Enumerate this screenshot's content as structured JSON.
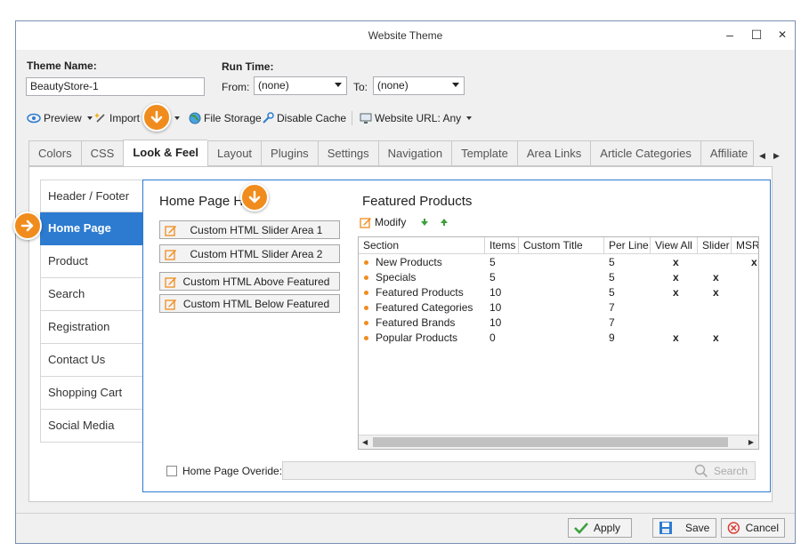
{
  "window": {
    "title": "Website Theme",
    "controls": {
      "minimize": "–",
      "maximize": "☐",
      "close": "✕"
    }
  },
  "header": {
    "theme_name_label": "Theme Name:",
    "theme_name_value": "BeautyStore-1",
    "run_time_label": "Run Time:",
    "from_label": "From:",
    "from_value": "(none)",
    "to_label": "To:",
    "to_value": "(none)"
  },
  "toolbar": {
    "preview": "Preview",
    "import": "Import",
    "file_storage": "File Storage",
    "disable_cache": "Disable Cache",
    "website_url": "Website URL: Any"
  },
  "tabs": [
    {
      "label": "Colors"
    },
    {
      "label": "CSS"
    },
    {
      "label": "Look & Feel"
    },
    {
      "label": "Layout"
    },
    {
      "label": "Plugins"
    },
    {
      "label": "Settings"
    },
    {
      "label": "Navigation"
    },
    {
      "label": "Template"
    },
    {
      "label": "Area Links"
    },
    {
      "label": "Article Categories"
    },
    {
      "label": "Affiliate"
    }
  ],
  "side_nav": [
    {
      "label": "Header / Footer"
    },
    {
      "label": "Home Page"
    },
    {
      "label": "Product"
    },
    {
      "label": "Search"
    },
    {
      "label": "Registration"
    },
    {
      "label": "Contact Us"
    },
    {
      "label": "Shopping Cart"
    },
    {
      "label": "Social Media"
    }
  ],
  "home_page": {
    "title": "Home Page H",
    "buttons": [
      {
        "label": "Custom HTML Slider Area 1"
      },
      {
        "label": "Custom HTML Slider Area 2"
      },
      {
        "label": "Custom HTML Above Featured"
      },
      {
        "label": "Custom HTML Below Featured"
      }
    ]
  },
  "featured": {
    "title": "Featured Products",
    "modify_label": "Modify",
    "columns": [
      "Section",
      "Items",
      "Custom Title",
      "Per Line",
      "View All",
      "Slider",
      "MSR"
    ],
    "rows": [
      {
        "section": "New Products",
        "items": "5",
        "custom_title": "",
        "per_line": "5",
        "view_all": "x",
        "slider": "",
        "msr": "x"
      },
      {
        "section": "Specials",
        "items": "5",
        "custom_title": "",
        "per_line": "5",
        "view_all": "x",
        "slider": "x",
        "msr": ""
      },
      {
        "section": "Featured Products",
        "items": "10",
        "custom_title": "",
        "per_line": "5",
        "view_all": "x",
        "slider": "x",
        "msr": ""
      },
      {
        "section": "Featured Categories",
        "items": "10",
        "custom_title": "",
        "per_line": "7",
        "view_all": "",
        "slider": "",
        "msr": ""
      },
      {
        "section": "Featured Brands",
        "items": "10",
        "custom_title": "",
        "per_line": "7",
        "view_all": "",
        "slider": "",
        "msr": ""
      },
      {
        "section": "Popular Products",
        "items": "0",
        "custom_title": "",
        "per_line": "9",
        "view_all": "x",
        "slider": "x",
        "msr": ""
      }
    ]
  },
  "override": {
    "label": "Home Page Overide:",
    "search_label": "Search"
  },
  "footer": {
    "apply": "Apply",
    "save": "Save",
    "cancel": "Cancel"
  },
  "colors": {
    "accent": "#2d7bd0",
    "callout": "#f08c1d"
  }
}
